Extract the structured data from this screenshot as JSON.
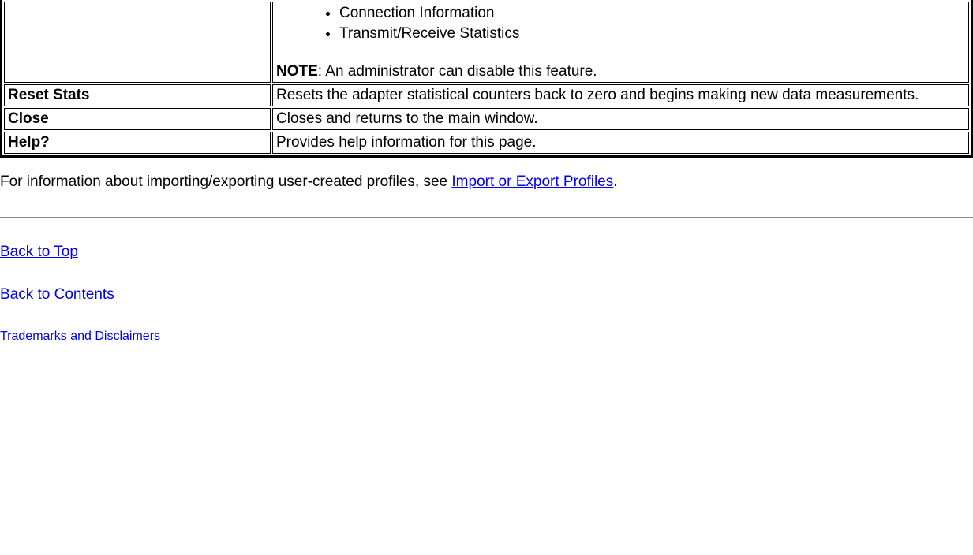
{
  "table": {
    "row0": {
      "bullets": [
        "Connection Information",
        "Transmit/Receive Statistics"
      ],
      "note_label": "NOTE",
      "note_text": ": An administrator can disable this feature."
    },
    "row1": {
      "label": "Reset Stats",
      "desc": "Resets the adapter statistical counters back to zero and begins making new data measurements."
    },
    "row2": {
      "label": "Close",
      "desc": "Closes and returns to the main window."
    },
    "row3": {
      "label": "Help?",
      "desc": "Provides help information for this page."
    }
  },
  "paragraph": {
    "prefix": "For information about importing/exporting user-created profiles, see ",
    "link": "Import or Export Profiles",
    "suffix": "."
  },
  "links": {
    "back_to_top": "Back to Top",
    "back_to_contents": "Back to Contents",
    "trademarks": "Trademarks and Disclaimers"
  }
}
